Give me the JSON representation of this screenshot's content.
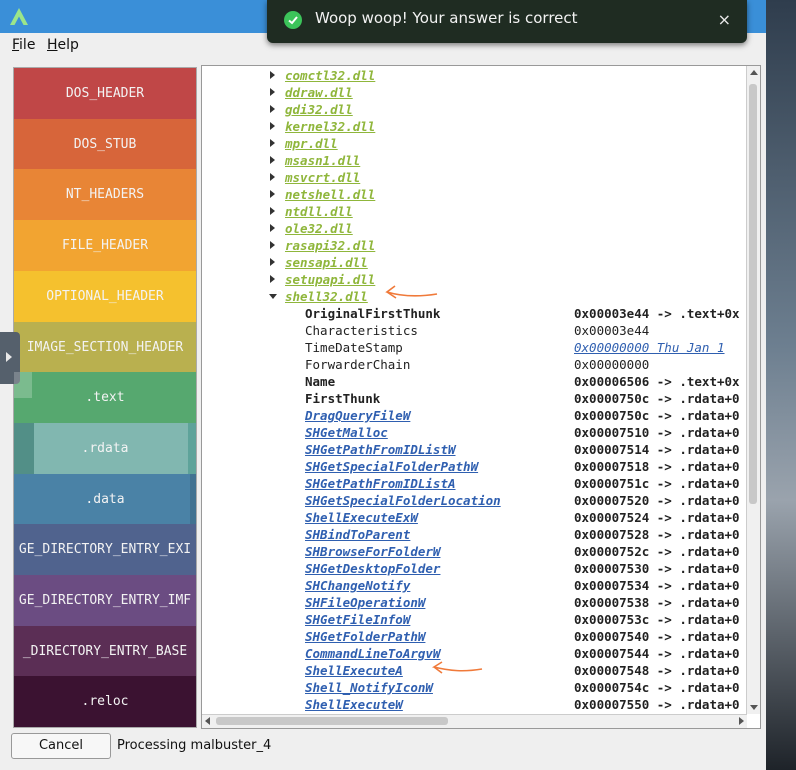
{
  "menu": {
    "file": "File",
    "help": "Help"
  },
  "sections": [
    {
      "label": "DOS_HEADER",
      "color": "#c04747"
    },
    {
      "label": "DOS_STUB",
      "color": "#d7653a"
    },
    {
      "label": "NT_HEADERS",
      "color": "#e88536"
    },
    {
      "label": "FILE_HEADER",
      "color": "#f2a431"
    },
    {
      "label": "OPTIONAL_HEADER",
      "color": "#f5c12e"
    },
    {
      "label": "IMAGE_SECTION_HEADER",
      "color": "#b9b04f"
    },
    {
      "label": ".text",
      "color": "#56a86f"
    },
    {
      "label": ".rdata",
      "color": "#5ea39a"
    },
    {
      "label": ".data",
      "color": "#4a82a6"
    },
    {
      "label": "GE_DIRECTORY_ENTRY_EXI",
      "color": "#50638e"
    },
    {
      "label": "GE_DIRECTORY_ENTRY_IMF",
      "color": "#6b4c82"
    },
    {
      "label": "_DIRECTORY_ENTRY_BASE",
      "color": "#5b2e55"
    },
    {
      "label": ".reloc",
      "color": "#3b1231"
    }
  ],
  "dlls": [
    "comctl32.dll",
    "ddraw.dll",
    "gdi32.dll",
    "kernel32.dll",
    "mpr.dll",
    "msasn1.dll",
    "msvcrt.dll",
    "netshell.dll",
    "ntdll.dll",
    "ole32.dll",
    "rasapi32.dll",
    "sensapi.dll",
    "setupapi.dll"
  ],
  "expanded_dll": "shell32.dll",
  "fields": [
    {
      "name": "OriginalFirstThunk",
      "value": "0x00003e44 -> .text+0x"
    },
    {
      "name": "Characteristics",
      "value": "0x00003e44"
    },
    {
      "name": "TimeDateStamp",
      "value": "0x00000000 Thu Jan  1"
    },
    {
      "name": "ForwarderChain",
      "value": "0x00000000"
    },
    {
      "name": "Name",
      "value": "0x00006506 -> .text+0x"
    },
    {
      "name": "FirstThunk",
      "value": "0x0000750c -> .rdata+0"
    }
  ],
  "functions": [
    {
      "name": "DragQueryFileW",
      "value": "0x0000750c -> .rdata+0"
    },
    {
      "name": "SHGetMalloc",
      "value": "0x00007510 -> .rdata+0"
    },
    {
      "name": "SHGetPathFromIDListW",
      "value": "0x00007514 -> .rdata+0"
    },
    {
      "name": "SHGetSpecialFolderPathW",
      "value": "0x00007518 -> .rdata+0"
    },
    {
      "name": "SHGetPathFromIDListA",
      "value": "0x0000751c -> .rdata+0"
    },
    {
      "name": "SHGetSpecialFolderLocation",
      "value": "0x00007520 -> .rdata+0"
    },
    {
      "name": "ShellExecuteExW",
      "value": "0x00007524 -> .rdata+0"
    },
    {
      "name": "SHBindToParent",
      "value": "0x00007528 -> .rdata+0"
    },
    {
      "name": "SHBrowseForFolderW",
      "value": "0x0000752c -> .rdata+0"
    },
    {
      "name": "SHGetDesktopFolder",
      "value": "0x00007530 -> .rdata+0"
    },
    {
      "name": "SHChangeNotify",
      "value": "0x00007534 -> .rdata+0"
    },
    {
      "name": "SHFileOperationW",
      "value": "0x00007538 -> .rdata+0"
    },
    {
      "name": "SHGetFileInfoW",
      "value": "0x0000753c -> .rdata+0"
    },
    {
      "name": "SHGetFolderPathW",
      "value": "0x00007540 -> .rdata+0"
    },
    {
      "name": "CommandLineToArgvW",
      "value": "0x00007544 -> .rdata+0"
    },
    {
      "name": "ShellExecuteA",
      "value": "0x00007548 -> .rdata+0"
    },
    {
      "name": "Shell_NotifyIconW",
      "value": "0x0000754c -> .rdata+0"
    },
    {
      "name": "ShellExecuteW",
      "value": "0x00007550 -> .rdata+0"
    }
  ],
  "footer": {
    "cancel": "Cancel",
    "status": "Processing malbuster_4"
  },
  "toast": {
    "message": "Woop woop! Your answer is correct",
    "close": "×"
  },
  "colors": {
    "titlebar": "#3a8fd8",
    "dll_link": "#8fb63b",
    "func_link": "#2f5fb0",
    "annotation": "#f07a3a",
    "toast_check": "#3cc45a"
  }
}
